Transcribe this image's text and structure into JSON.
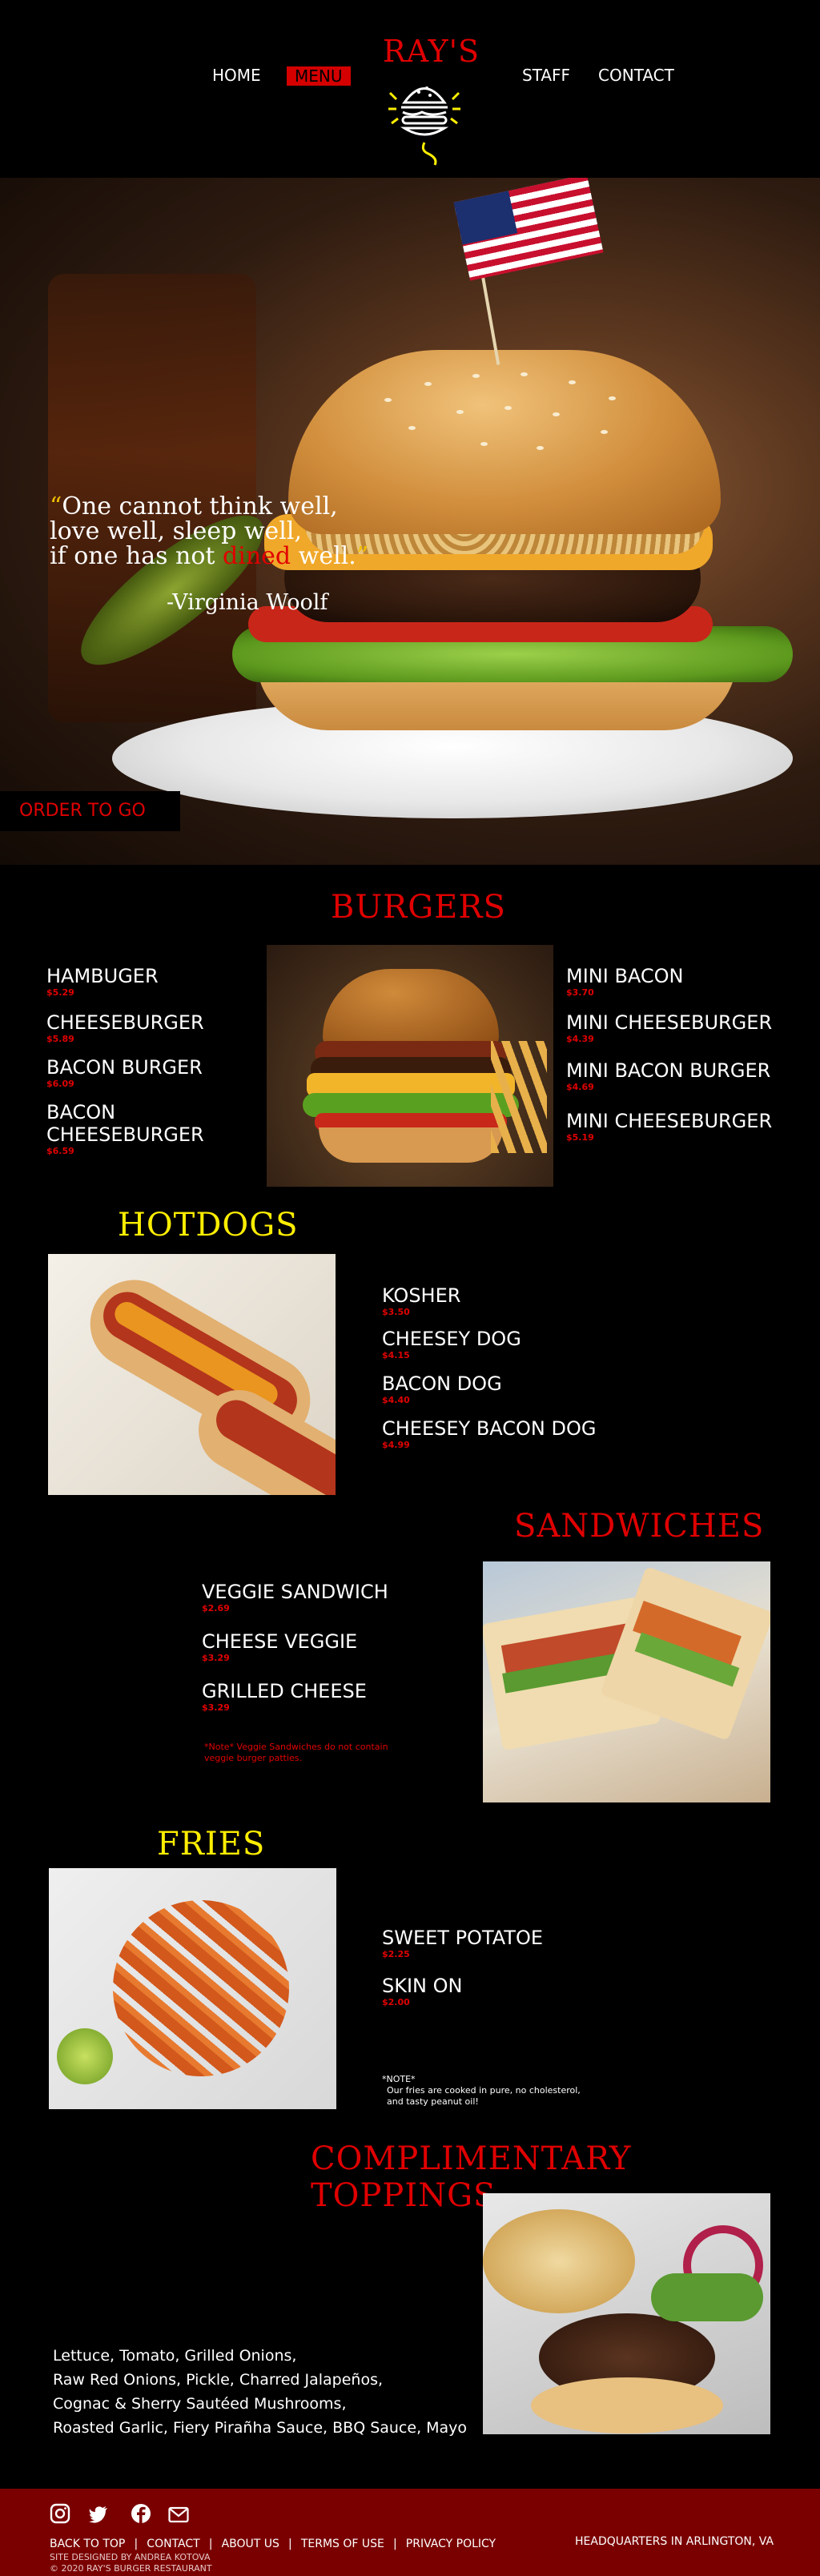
{
  "nav": {
    "home": "HOME",
    "menu": "MENU",
    "staff": "STAFF",
    "contact": "CONTACT",
    "logo_text": "RAY'S"
  },
  "hero": {
    "quote_open": "“",
    "quote_line1": "One cannot think well,",
    "quote_line2": "love well, sleep well,",
    "quote_line3_pre": "if one has not ",
    "quote_line3_hl": "dined",
    "quote_line3_post": " well.",
    "quote_close": "”",
    "author": "-Virginia Woolf",
    "order_button": "ORDER TO GO"
  },
  "burgers": {
    "title": "BURGERS",
    "left": [
      {
        "name": "HAMBUGER",
        "price": "$5.29"
      },
      {
        "name": "CHEESEBURGER",
        "price": "$5.89"
      },
      {
        "name": "BACON BURGER",
        "price": "$6.09"
      },
      {
        "name": "BACON CHEESEBURGER",
        "price": "$6.59"
      }
    ],
    "right": [
      {
        "name": "MINI BACON",
        "price": "$3.70"
      },
      {
        "name": "MINI CHEESEBURGER",
        "price": "$4.39"
      },
      {
        "name": "MINI BACON BURGER",
        "price": "$4.69"
      },
      {
        "name": "MINI CHEESEBURGER",
        "price": "$5.19"
      }
    ]
  },
  "hotdogs": {
    "title": "HOTDOGS",
    "items": [
      {
        "name": "KOSHER",
        "price": "$3.50"
      },
      {
        "name": "CHEESEY DOG",
        "price": "$4.15"
      },
      {
        "name": "BACON DOG",
        "price": "$4.40"
      },
      {
        "name": "CHEESEY BACON DOG",
        "price": "$4.99"
      }
    ]
  },
  "sandwiches": {
    "title": "SANDWICHES",
    "items": [
      {
        "name": "VEGGIE SANDWICH",
        "price": "$2.69"
      },
      {
        "name": "CHEESE VEGGIE",
        "price": "$3.29"
      },
      {
        "name": "GRILLED CHEESE",
        "price": "$3.29"
      }
    ],
    "note_line1": "*Note* Veggie Sandwiches do not contain",
    "note_line2": "veggie burger patties."
  },
  "fries": {
    "title": "FRIES",
    "items": [
      {
        "name": "SWEET POTATOE",
        "price": "$2.25"
      },
      {
        "name": "SKIN ON",
        "price": "$2.00"
      }
    ],
    "note_title": "*NOTE*",
    "note_line1": "Our fries are cooked in pure, no cholesterol,",
    "note_line2": "and tasty peanut oil!"
  },
  "toppings": {
    "title": "COMPLIMENTARY TOPPINGS",
    "line1": "Lettuce, Tomato, Grilled Onions,",
    "line2": "Raw Red Onions, Pickle, Charred Jalapeños,",
    "line3": "Cognac & Sherry Sautéed Mushrooms,",
    "line4": "Roasted Garlic, Fiery Pirañha Sauce, BBQ Sauce, Mayo"
  },
  "footer": {
    "links": [
      "BACK TO TOP",
      "CONTACT",
      "ABOUT US",
      "TERMS OF USE",
      "PRIVACY POLICY"
    ],
    "separator": "|",
    "designed": "SITE DESIGNED BY ANDREA KOTOVA",
    "copyright": "© 2020 RAY'S BURGER RESTAURANT",
    "hq": "HEADQUARTERS IN ARLINGTON, VA"
  },
  "colors": {
    "accent_red": "#e00000",
    "accent_yellow": "#ffee00",
    "footer_bg": "#7a0000",
    "background": "#000000"
  },
  "icons": [
    "instagram-icon",
    "twitter-icon",
    "facebook-icon",
    "mail-icon",
    "burger-logo-icon"
  ]
}
